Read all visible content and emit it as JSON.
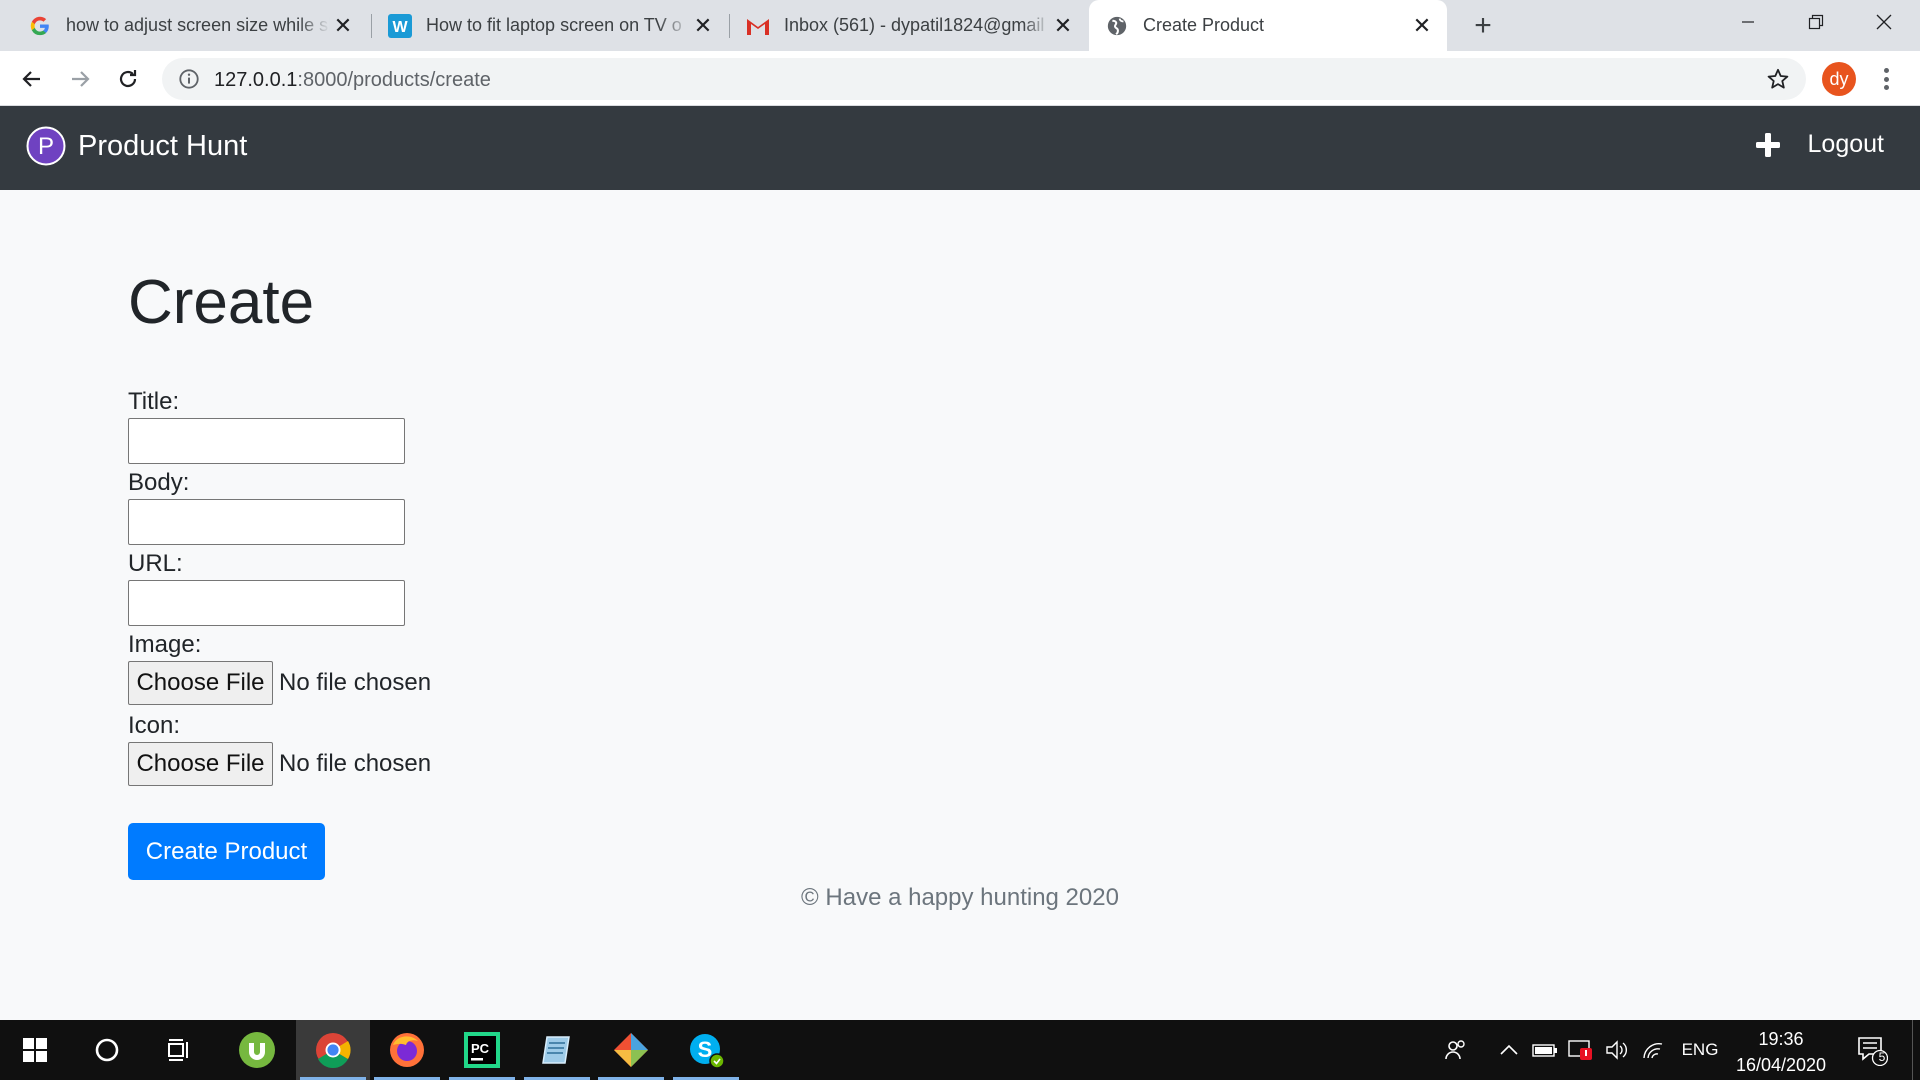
{
  "browser": {
    "tabs": [
      {
        "title": "how to adjust screen size while sl",
        "favicon": "google-icon",
        "active": false
      },
      {
        "title": "How to fit laptop screen on TV o",
        "favicon": "wikihow-icon",
        "active": false
      },
      {
        "title": "Inbox (561) - dypatil1824@gmail",
        "favicon": "gmail-icon",
        "active": false
      },
      {
        "title": "Create Product",
        "favicon": "globe-icon",
        "active": true
      }
    ],
    "url_host": "127.0.0.1",
    "url_path": ":8000/products/create",
    "profile_initials": "dy"
  },
  "site": {
    "brand": "Product Hunt",
    "logo_letter": "P",
    "logout_label": "Logout"
  },
  "form": {
    "heading": "Create",
    "title_label": "Title:",
    "body_label": "Body:",
    "url_label": "URL:",
    "image_label": "Image:",
    "icon_label": "Icon:",
    "choose_file_label": "Choose File",
    "no_file_text": "No file chosen",
    "submit_label": "Create Product"
  },
  "footer": {
    "text": "© Have a happy hunting 2020"
  },
  "taskbar": {
    "apps": [
      "utorrent-icon",
      "chrome-icon",
      "firefox-icon",
      "pycharm-icon",
      "notepad-icon",
      "git-icon",
      "skype-icon"
    ],
    "language": "ENG",
    "time": "19:36",
    "date": "16/04/2020",
    "notification_count": "5"
  },
  "colors": {
    "navbar_bg": "#343a40",
    "primary_button": "#007bff",
    "page_bg": "#f8f9fa"
  }
}
